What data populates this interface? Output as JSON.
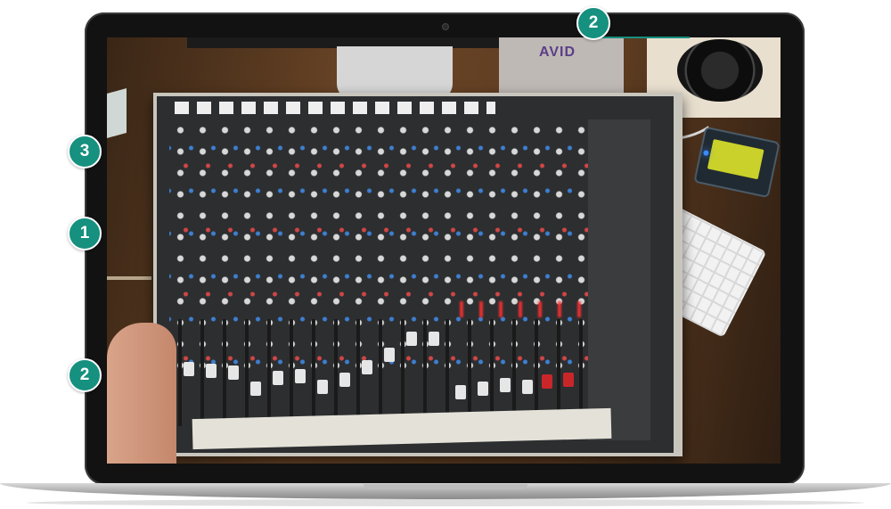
{
  "callouts": [
    {
      "label": "2"
    },
    {
      "label": "3"
    },
    {
      "label": "1"
    },
    {
      "label": "2"
    }
  ],
  "photo": {
    "brand_logo": "AVID"
  },
  "colors": {
    "callout_bg": "#16907f",
    "laptop_frame": "#121212",
    "laptop_base": "#c9c9c9"
  }
}
